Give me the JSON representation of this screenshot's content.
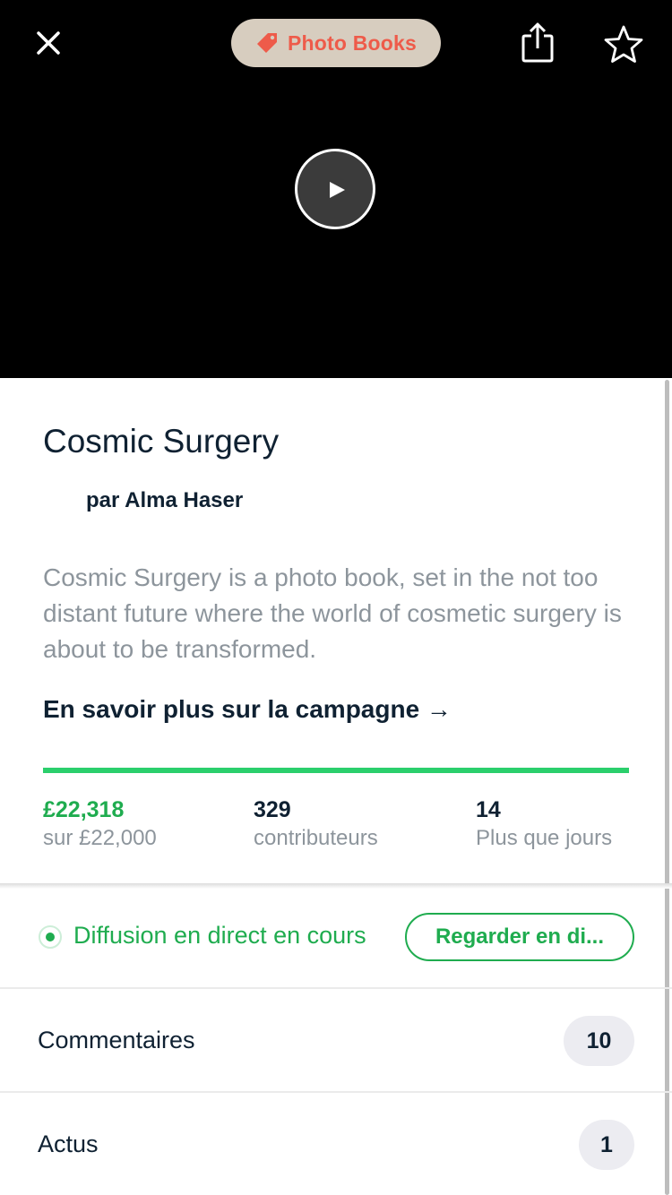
{
  "header": {
    "category_tag": "Photo Books",
    "close_icon": "close-icon",
    "share_icon": "share-icon",
    "star_icon": "star-icon",
    "play_icon": "play-icon"
  },
  "project": {
    "title": "Cosmic Surgery",
    "author": "par Alma Haser",
    "blurb": "Cosmic Surgery is a photo book, set in the not too distant future where the world of cosmetic surgery is about to be transformed.",
    "learn_more": "En savoir plus sur la campagne →"
  },
  "funding": {
    "progress_fraction": 1.0,
    "pledged": "£22,318",
    "goal": "sur £22,000",
    "backers_count": "329",
    "backers_label": "contributeurs",
    "days_count": "14",
    "days_label": "Plus que jours"
  },
  "live": {
    "status_text": "Diffusion en direct en cours",
    "watch_button": "Regarder en di..."
  },
  "sections": [
    {
      "label": "Commentaires",
      "count": "10"
    },
    {
      "label": "Actus",
      "count": "1"
    }
  ],
  "colors": {
    "accent_green": "#1fac4f",
    "progress_green": "#2bcf6c",
    "tag_background": "#d7cdbf",
    "tag_text": "#ee5b4a",
    "text_dark": "#0f2132",
    "text_muted": "#8d959c"
  }
}
